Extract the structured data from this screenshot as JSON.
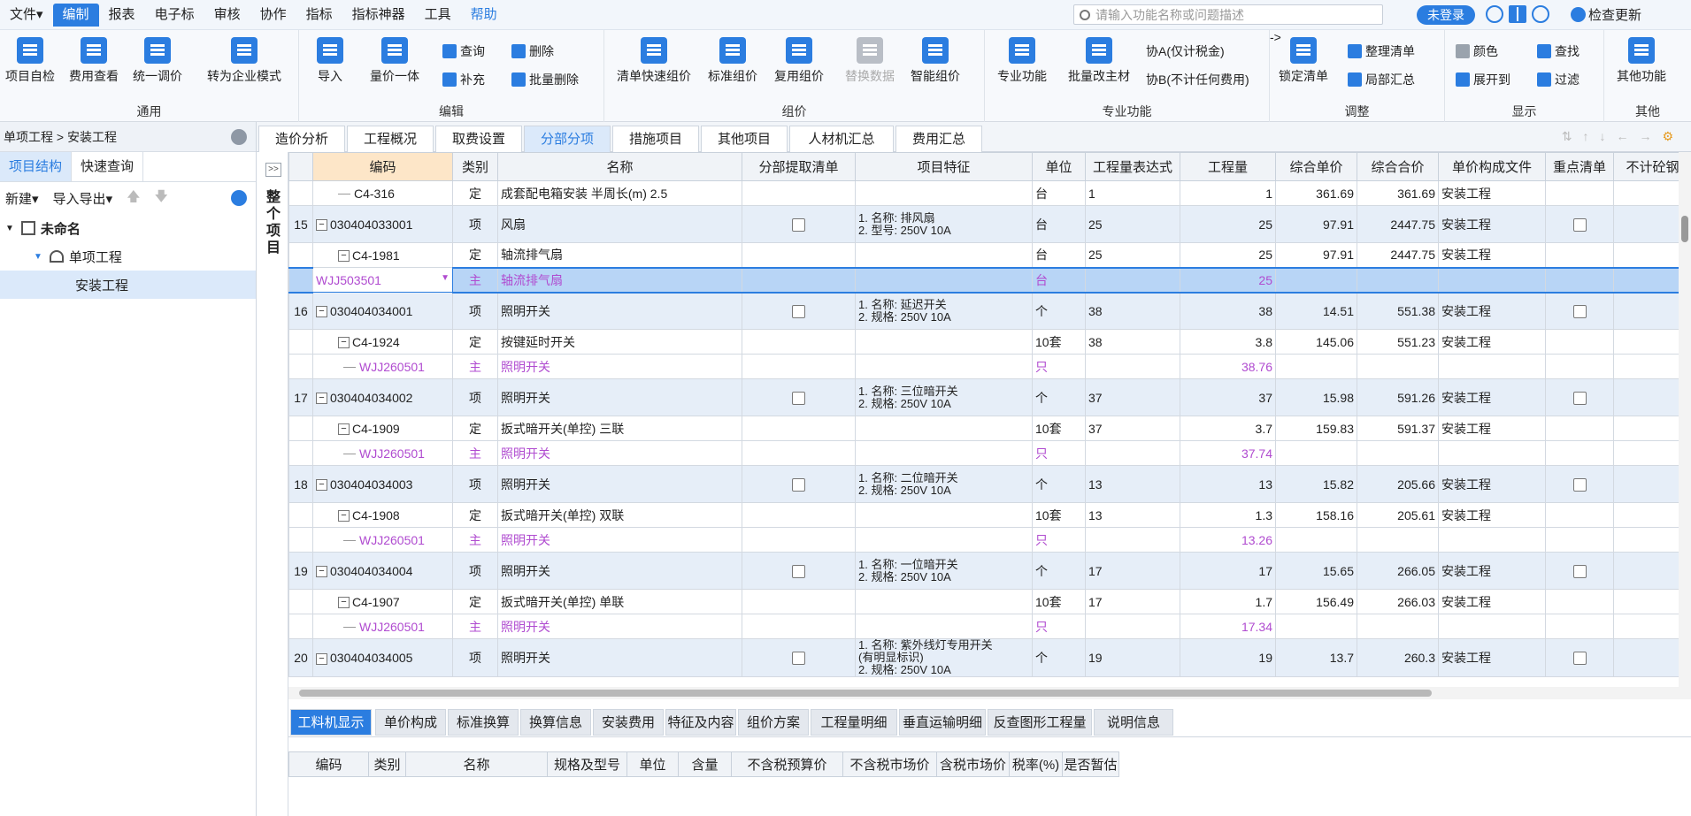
{
  "menu": [
    {
      "label": "文件",
      "dropdown": true
    },
    {
      "label": "编制",
      "active": true
    },
    {
      "label": "报表"
    },
    {
      "label": "电子标"
    },
    {
      "label": "审核"
    },
    {
      "label": "协作"
    },
    {
      "label": "指标"
    },
    {
      "label": "指标神器"
    },
    {
      "label": "工具"
    },
    {
      "label": "帮助",
      "help": true
    }
  ],
  "search": {
    "placeholder": "请输入功能名称或问题描述"
  },
  "login_label": "未登录",
  "update_label": "检查更新",
  "ribbon": {
    "groups": [
      "通用",
      "编辑",
      "组价",
      "专业功能",
      "调整",
      "显示",
      "其他"
    ],
    "general": [
      "项目自检",
      "费用查看",
      "统一调价",
      "转为企业模式"
    ],
    "edit_big": [
      "导入",
      "量价一体"
    ],
    "edit_small": [
      "查询",
      "删除",
      "补充",
      "批量删除"
    ],
    "price": [
      "清单快速组价",
      "标准组价",
      "复用组价",
      "替换数据",
      "智能组价"
    ],
    "prof_big": [
      "专业功能",
      "批量改主材"
    ],
    "prof_small": [
      "协A(仅计税金)",
      "协B(不计任何费用)"
    ],
    "adjust_big": "锁定清单",
    "adjust_small": [
      "整理清单",
      "局部汇总"
    ],
    "display": [
      "颜色",
      "查找",
      "展开到",
      "过滤"
    ],
    "other": "其他功能"
  },
  "left": {
    "breadcrumb": "单项工程 > 安装工程",
    "tabs": [
      "项目结构",
      "快速查询"
    ],
    "tools": [
      "新建",
      "导入导出"
    ],
    "tree": [
      "未命名",
      "单项工程",
      "安装工程"
    ]
  },
  "side_strip": {
    "label": "整个项目"
  },
  "tabs": [
    "造价分析",
    "工程概况",
    "取费设置",
    "分部分项",
    "措施项目",
    "其他项目",
    "人材机汇总",
    "费用汇总"
  ],
  "grid": {
    "headers": [
      "编码",
      "类别",
      "名称",
      "分部提取清单",
      "项目特征",
      "单位",
      "工程量表达式",
      "工程量",
      "综合单价",
      "综合合价",
      "单价构成文件",
      "重点清单",
      "不计砼钢"
    ],
    "rows": [
      {
        "type": "sub",
        "code": "C4-316",
        "cat": "定",
        "name": "成套配电箱安装 半周长(m) 2.5",
        "unit": "台",
        "expr": "1",
        "qty": "1",
        "price": "361.69",
        "total": "361.69",
        "file": "安装工程"
      },
      {
        "type": "item",
        "idx": "15",
        "code": "030404033001",
        "cat": "项",
        "name": "风扇",
        "feat1": "1. 名称: 排风扇",
        "feat2": "2. 型号: 250V 10A",
        "unit": "台",
        "expr": "25",
        "qty": "25",
        "price": "97.91",
        "total": "2447.75",
        "file": "安装工程"
      },
      {
        "type": "sub",
        "code": "C4-1981",
        "cat": "定",
        "name": "轴流排气扇",
        "unit": "台",
        "expr": "25",
        "qty": "25",
        "price": "97.91",
        "total": "2447.75",
        "file": "安装工程"
      },
      {
        "type": "sel",
        "code": "WJJ503501",
        "cat": "主",
        "name": "轴流排气扇",
        "unit": "台",
        "qty": "25"
      },
      {
        "type": "item",
        "idx": "16",
        "code": "030404034001",
        "cat": "项",
        "name": "照明开关",
        "feat1": "1. 名称: 延迟开关",
        "feat2": "2. 规格: 250V 10A",
        "unit": "个",
        "expr": "38",
        "qty": "38",
        "price": "14.51",
        "total": "551.38",
        "file": "安装工程"
      },
      {
        "type": "sub",
        "code": "C4-1924",
        "cat": "定",
        "name": "按键延时开关",
        "unit": "10套",
        "expr": "38",
        "qty": "3.8",
        "price": "145.06",
        "total": "551.23",
        "file": "安装工程"
      },
      {
        "type": "main",
        "code": "WJJ260501",
        "cat": "主",
        "name": "照明开关",
        "unit": "只",
        "qty": "38.76"
      },
      {
        "type": "item",
        "idx": "17",
        "code": "030404034002",
        "cat": "项",
        "name": "照明开关",
        "feat1": "1. 名称: 三位暗开关",
        "feat2": "2. 规格: 250V 10A",
        "unit": "个",
        "expr": "37",
        "qty": "37",
        "price": "15.98",
        "total": "591.26",
        "file": "安装工程"
      },
      {
        "type": "sub",
        "code": "C4-1909",
        "cat": "定",
        "name": "扳式暗开关(单控) 三联",
        "unit": "10套",
        "expr": "37",
        "qty": "3.7",
        "price": "159.83",
        "total": "591.37",
        "file": "安装工程"
      },
      {
        "type": "main",
        "code": "WJJ260501",
        "cat": "主",
        "name": "照明开关",
        "unit": "只",
        "qty": "37.74"
      },
      {
        "type": "item",
        "idx": "18",
        "code": "030404034003",
        "cat": "项",
        "name": "照明开关",
        "feat1": "1. 名称: 二位暗开关",
        "feat2": "2. 规格: 250V 10A",
        "unit": "个",
        "expr": "13",
        "qty": "13",
        "price": "15.82",
        "total": "205.66",
        "file": "安装工程"
      },
      {
        "type": "sub",
        "code": "C4-1908",
        "cat": "定",
        "name": "扳式暗开关(单控) 双联",
        "unit": "10套",
        "expr": "13",
        "qty": "1.3",
        "price": "158.16",
        "total": "205.61",
        "file": "安装工程"
      },
      {
        "type": "main",
        "code": "WJJ260501",
        "cat": "主",
        "name": "照明开关",
        "unit": "只",
        "qty": "13.26"
      },
      {
        "type": "item",
        "idx": "19",
        "code": "030404034004",
        "cat": "项",
        "name": "照明开关",
        "feat1": "1. 名称: 一位暗开关",
        "feat2": "2. 规格: 250V 10A",
        "unit": "个",
        "expr": "17",
        "qty": "17",
        "price": "15.65",
        "total": "266.05",
        "file": "安装工程"
      },
      {
        "type": "sub",
        "code": "C4-1907",
        "cat": "定",
        "name": "扳式暗开关(单控) 单联",
        "unit": "10套",
        "expr": "17",
        "qty": "1.7",
        "price": "156.49",
        "total": "266.03",
        "file": "安装工程"
      },
      {
        "type": "main",
        "code": "WJJ260501",
        "cat": "主",
        "name": "照明开关",
        "unit": "只",
        "qty": "17.34"
      },
      {
        "type": "item",
        "idx": "20",
        "code": "030404034005",
        "cat": "项",
        "name": "照明开关",
        "feat1": "1. 名称: 紫外线灯专用开关",
        "feat2": "(有明显标识)",
        "feat3": "2. 规格: 250V 10A",
        "unit": "个",
        "expr": "19",
        "qty": "19",
        "price": "13.7",
        "total": "260.3",
        "file": "安装工程"
      }
    ]
  },
  "bottom_tabs": [
    "工料机显示",
    "单价构成",
    "标准换算",
    "换算信息",
    "安装费用",
    "特征及内容",
    "组价方案",
    "工程量明细",
    "垂直运输明细",
    "反查图形工程量",
    "说明信息"
  ],
  "sub_headers": [
    "编码",
    "类别",
    "名称",
    "规格及型号",
    "单位",
    "含量",
    "不含税预算价",
    "不含税市场价",
    "含税市场价",
    "税率(%)",
    "是否暂估"
  ],
  "colors": {
    "accent": "#2b7de0",
    "item_row": "#e6eef8",
    "selected_row": "#b8d5f6",
    "material_text": "#b04bd0"
  }
}
